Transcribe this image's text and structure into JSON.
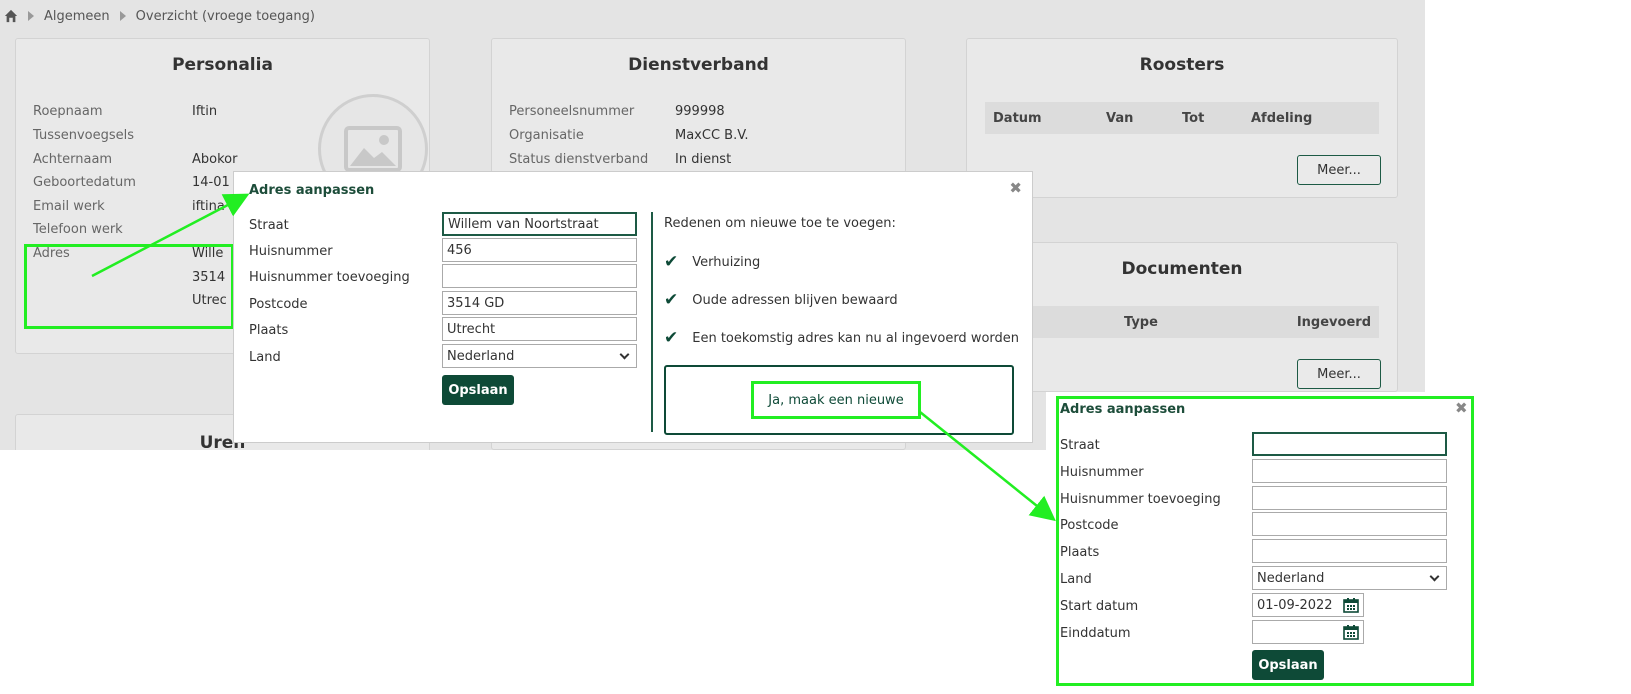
{
  "breadcrumb": {
    "item1": "Algemeen",
    "item2": "Overzicht (vroege toegang)"
  },
  "personalia": {
    "title": "Personalia",
    "fields": [
      {
        "label": "Roepnaam",
        "value": "Iftin"
      },
      {
        "label": "Tussenvoegsels",
        "value": ""
      },
      {
        "label": "Achternaam",
        "value": "Abokor"
      },
      {
        "label": "Geboortedatum",
        "value": "14-01"
      },
      {
        "label": "Email werk",
        "value": "iftina"
      },
      {
        "label": "Telefoon werk",
        "value": ""
      },
      {
        "label": "Adres",
        "value": "Wille"
      }
    ],
    "address_line2": "3514",
    "address_line3": "Utrec"
  },
  "dienstverband": {
    "title": "Dienstverband",
    "fields": [
      {
        "label": "Personeelsnummer",
        "value": "999998"
      },
      {
        "label": "Organisatie",
        "value": "MaxCC B.V."
      },
      {
        "label": "Status dienstverband",
        "value": "In dienst"
      }
    ]
  },
  "roosters": {
    "title": "Roosters",
    "columns": [
      "Datum",
      "Van",
      "Tot",
      "Afdeling"
    ],
    "more": "Meer..."
  },
  "documenten": {
    "title": "Documenten",
    "columns": [
      "Type",
      "Ingevoerd"
    ],
    "more": "Meer..."
  },
  "uren": {
    "title": "Uren"
  },
  "dialog1": {
    "title": "Adres aanpassen",
    "labels": {
      "straat": "Straat",
      "huisnummer": "Huisnummer",
      "toevoeging": "Huisnummer toevoeging",
      "postcode": "Postcode",
      "plaats": "Plaats",
      "land": "Land"
    },
    "values": {
      "straat": "Willem van Noortstraat",
      "huisnummer": "456",
      "toevoeging": "",
      "postcode": "3514 GD",
      "plaats": "Utrecht",
      "land": "Nederland"
    },
    "save": "Opslaan",
    "reasons_title": "Redenen om nieuwe toe te voegen:",
    "reasons": [
      "Verhuizing",
      "Oude adressen blijven bewaard",
      "Een toekomstig adres kan nu al ingevoerd worden"
    ],
    "new_button": "Ja, maak een nieuwe"
  },
  "dialog2": {
    "title": "Adres aanpassen",
    "labels": {
      "straat": "Straat",
      "huisnummer": "Huisnummer",
      "toevoeging": "Huisnummer toevoeging",
      "postcode": "Postcode",
      "plaats": "Plaats",
      "land": "Land",
      "start": "Start datum",
      "eind": "Einddatum"
    },
    "values": {
      "straat": "",
      "huisnummer": "",
      "toevoeging": "",
      "postcode": "",
      "plaats": "",
      "land": "Nederland",
      "start": "01-09-2022",
      "eind": ""
    },
    "save": "Opslaan"
  },
  "colors": {
    "accent": "#0e4a37",
    "highlight": "#22ee22",
    "background": "#e4e4e4"
  }
}
